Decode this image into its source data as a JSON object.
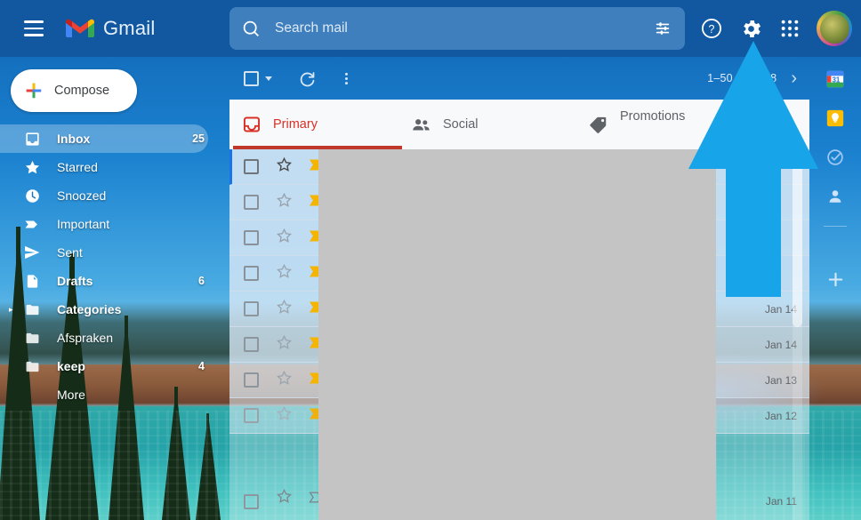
{
  "header": {
    "menu_icon": "hamburger-menu-icon",
    "brand": "Gmail",
    "logo_icon": "gmail-m-logo",
    "search": {
      "icon": "search-icon",
      "placeholder": "Search mail",
      "value": "",
      "filter_icon": "search-options-icon"
    },
    "help_icon": "help-question-icon",
    "settings_icon": "gear-settings-icon",
    "apps_icon": "google-apps-grid-icon",
    "avatar_icon": "account-avatar"
  },
  "sidebar": {
    "compose": {
      "label": "Compose",
      "icon": "plus-icon"
    },
    "items": [
      {
        "label": "Inbox",
        "icon": "inbox-icon",
        "count": "25",
        "active": true,
        "bold": true,
        "caret": ""
      },
      {
        "label": "Starred",
        "icon": "star-icon",
        "count": "",
        "active": false,
        "bold": false,
        "caret": ""
      },
      {
        "label": "Snoozed",
        "icon": "clock-icon",
        "count": "",
        "active": false,
        "bold": false,
        "caret": ""
      },
      {
        "label": "Important",
        "icon": "important-icon",
        "count": "",
        "active": false,
        "bold": false,
        "caret": ""
      },
      {
        "label": "Sent",
        "icon": "send-icon",
        "count": "",
        "active": false,
        "bold": false,
        "caret": ""
      },
      {
        "label": "Drafts",
        "icon": "draft-file-icon",
        "count": "6",
        "active": false,
        "bold": true,
        "caret": ""
      },
      {
        "label": "Categories",
        "icon": "label-icon",
        "count": "",
        "active": false,
        "bold": true,
        "caret": "▸"
      },
      {
        "label": "Afspraken",
        "icon": "label-icon",
        "count": "",
        "active": false,
        "bold": false,
        "caret": ""
      },
      {
        "label": "keep",
        "icon": "label-icon",
        "count": "4",
        "active": false,
        "bold": true,
        "caret": ""
      },
      {
        "label": "More",
        "icon": "",
        "count": "",
        "active": false,
        "bold": false,
        "caret": ""
      }
    ]
  },
  "toolbar": {
    "select_all_icon": "select-all-checkbox",
    "select_all_caret_icon": "chevron-down-icon",
    "refresh_icon": "refresh-icon",
    "more_icon": "more-vertical-icon",
    "page_range": "1–50 of 1,118",
    "next_page_icon": "chevron-right-icon"
  },
  "tabs": [
    {
      "label": "Primary",
      "icon": "inbox-tab-icon",
      "active": true
    },
    {
      "label": "Social",
      "icon": "people-icon",
      "active": false
    },
    {
      "label": "Promotions",
      "icon": "price-tag-icon",
      "active": false
    }
  ],
  "mail_list": {
    "checkbox_icon": "checkbox-icon",
    "star_icon": "star-outline-icon",
    "importance_icon": "importance-marker-icon",
    "rows": [
      {
        "date": "",
        "selected": true,
        "importance": "filled"
      },
      {
        "date": "",
        "selected": false,
        "importance": "filled"
      },
      {
        "date": "",
        "selected": false,
        "importance": "filled"
      },
      {
        "date": "",
        "selected": false,
        "importance": "filled"
      },
      {
        "date": "Jan 14",
        "selected": false,
        "importance": "filled"
      },
      {
        "date": "Jan 14",
        "selected": false,
        "importance": "filled"
      },
      {
        "date": "Jan 13",
        "selected": false,
        "importance": "filled"
      },
      {
        "date": "Jan 12",
        "selected": false,
        "importance": "filled"
      },
      {
        "date": "Jan 11",
        "selected": false,
        "importance": "outline"
      }
    ]
  },
  "right_rail": {
    "items": [
      {
        "icon": "google-calendar-icon",
        "label": "31"
      },
      {
        "icon": "google-keep-icon",
        "label": ""
      },
      {
        "icon": "google-tasks-icon",
        "label": ""
      },
      {
        "icon": "google-contacts-icon",
        "label": ""
      }
    ],
    "add_icon": "add-plus-icon"
  },
  "annotation": {
    "arrow_icon": "up-arrow-annotation",
    "color": "#17a4e8",
    "points_to": "gear-settings-icon"
  },
  "colors": {
    "header_blue": "#1158a0",
    "accent_red": "#d93025",
    "tab_bar": "#f7f9fb",
    "redaction_gray": "#c4c4c4",
    "importance_yellow": "#f5b400"
  }
}
